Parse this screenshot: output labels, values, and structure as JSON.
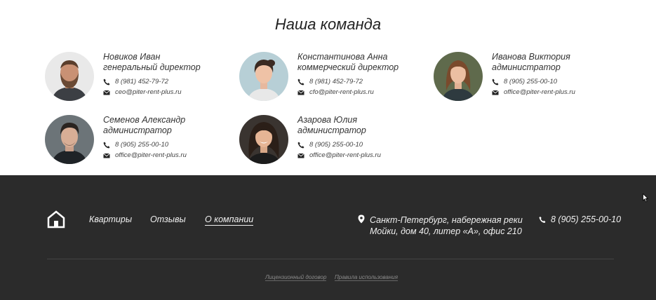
{
  "team": {
    "title": "Наша команда",
    "members": [
      {
        "name": "Новиков Иван",
        "role": "генеральный директор",
        "phone": "8 (981) 452-79-72",
        "email": "ceo@piter-rent-plus.ru"
      },
      {
        "name": "Константинова Анна",
        "role": "коммерческий директор",
        "phone": "8 (981) 452-79-72",
        "email": "cfo@piter-rent-plus.ru"
      },
      {
        "name": "Иванова Виктория",
        "role": "администратор",
        "phone": "8 (905) 255-00-10",
        "email": "office@piter-rent-plus.ru"
      },
      {
        "name": "Семенов Александр",
        "role": "администратор",
        "phone": "8 (905) 255-00-10",
        "email": "office@piter-rent-plus.ru"
      },
      {
        "name": "Азарова Юлия",
        "role": "администратор",
        "phone": "8 (905) 255-00-10",
        "email": "office@piter-rent-plus.ru"
      }
    ]
  },
  "footer": {
    "nav": [
      "Квартиры",
      "Отзывы",
      "О компании"
    ],
    "active_nav": "О компании",
    "address_line1": "Санкт-Петербург, набережная реки",
    "address_line2": "Мойки, дом 40, литер «А», офис 210",
    "phone": "8 (905) 255-00-10",
    "legal": [
      "Лицензионный договор",
      "Правила использования"
    ]
  },
  "colors": {
    "footer_bg": "#2b2b2b",
    "text": "#333333",
    "footer_text": "#f0f0f0"
  }
}
